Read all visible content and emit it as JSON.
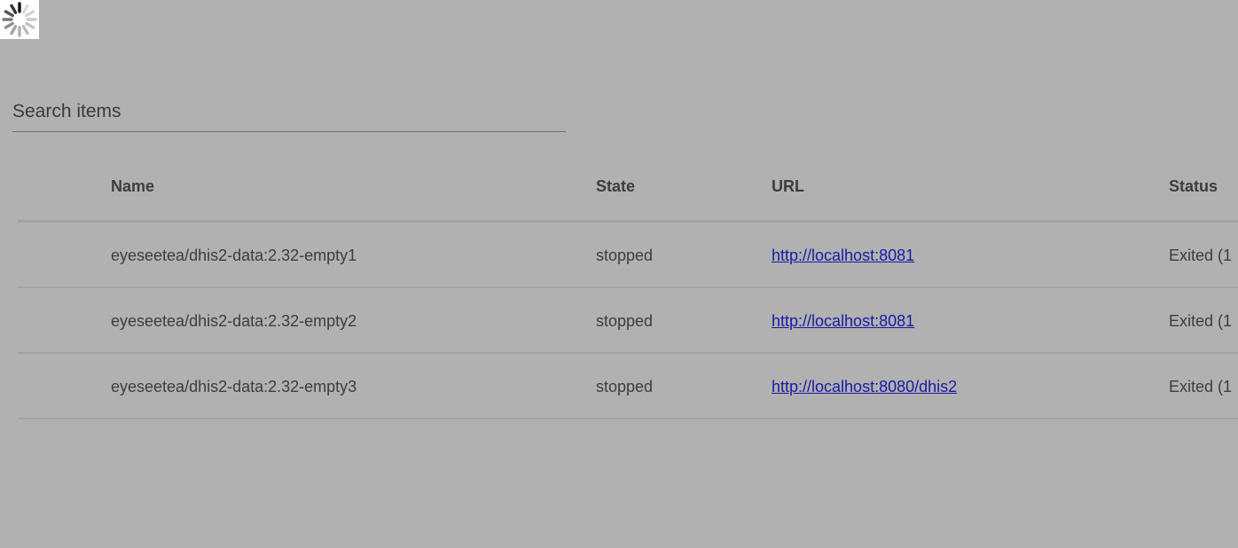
{
  "search": {
    "placeholder": "Search items",
    "value": ""
  },
  "table": {
    "columns": [
      "Name",
      "State",
      "URL",
      "Status"
    ],
    "rows": [
      {
        "name": "eyeseetea/dhis2-data:2.32-empty1",
        "state": "stopped",
        "url": "http://localhost:8081",
        "status": "Exited (1"
      },
      {
        "name": "eyeseetea/dhis2-data:2.32-empty2",
        "state": "stopped",
        "url": "http://localhost:8081",
        "status": "Exited (1"
      },
      {
        "name": "eyeseetea/dhis2-data:2.32-empty3",
        "state": "stopped",
        "url": "http://localhost:8080/dhis2",
        "status": "Exited (1"
      }
    ]
  },
  "colors": {
    "overlay_background": "#b1b1b1",
    "link": "#1a1aa6",
    "text": "#3d3d3d",
    "divider": "#a2a2a2"
  },
  "icons": {
    "loading": "loading-spinner-icon"
  }
}
